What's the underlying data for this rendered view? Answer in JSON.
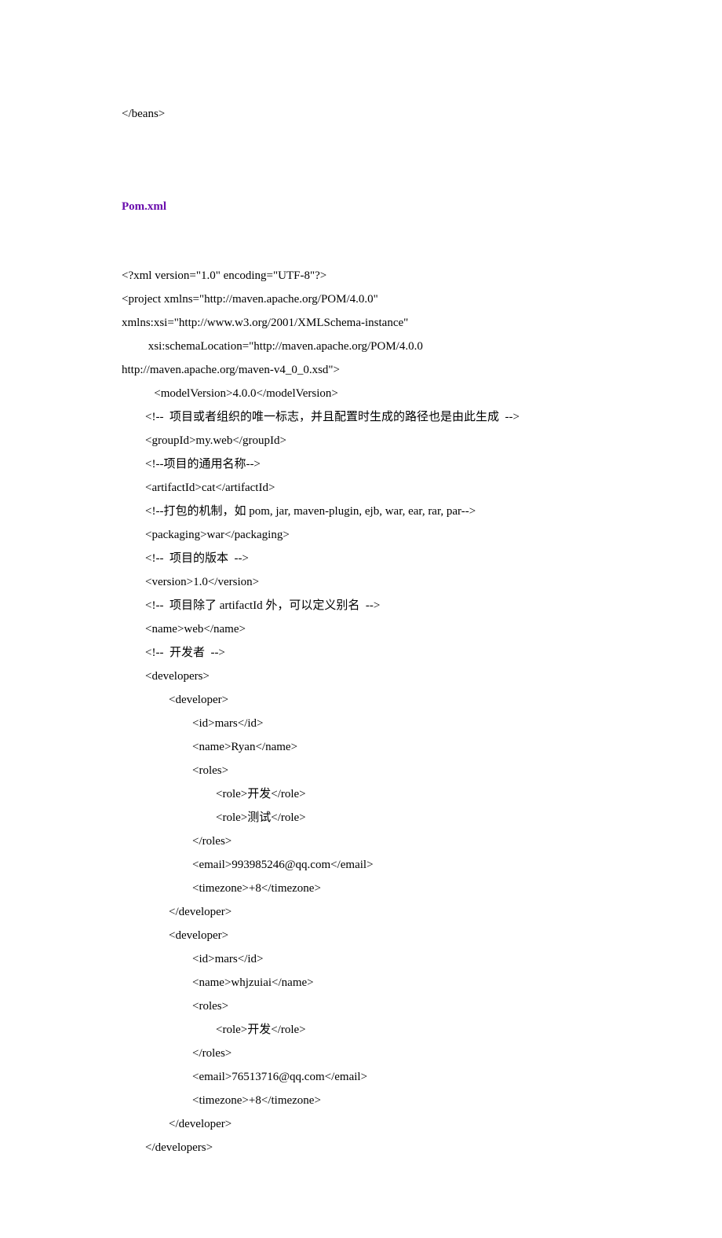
{
  "lines": [
    "</beans>",
    "",
    "",
    {
      "heading": true,
      "text": "Pom.xml"
    },
    "",
    "<?xml version=\"1.0\" encoding=\"UTF-8\"?>",
    "<project xmlns=\"http://maven.apache.org/POM/4.0.0\"",
    "xmlns:xsi=\"http://www.w3.org/2001/XMLSchema-instance\"",
    "         xsi:schemaLocation=\"http://maven.apache.org/POM/4.0.0",
    "http://maven.apache.org/maven-v4_0_0.xsd\">",
    "           <modelVersion>4.0.0</modelVersion>",
    "        <!--  项目或者组织的唯一标志，并且配置时生成的路径也是由此生成  -->",
    "        <groupId>my.web</groupId>",
    "        <!--项目的通用名称-->",
    "        <artifactId>cat</artifactId>",
    "        <!--打包的机制，如 pom, jar, maven-plugin, ejb, war, ear, rar, par-->",
    "        <packaging>war</packaging>",
    "        <!--  项目的版本  -->",
    "        <version>1.0</version>",
    "        <!--  项目除了 artifactId 外，可以定义别名  -->",
    "        <name>web</name>",
    "        <!--  开发者  -->",
    "        <developers>",
    "                <developer>",
    "                        <id>mars</id>",
    "                        <name>Ryan</name>",
    "                        <roles>",
    "                                <role>开发</role>",
    "                                <role>测试</role>",
    "                        </roles>",
    "                        <email>993985246@qq.com</email>",
    "                        <timezone>+8</timezone>",
    "                </developer>",
    "                <developer>",
    "                        <id>mars</id>",
    "                        <name>whjzuiai</name>",
    "                        <roles>",
    "                                <role>开发</role>",
    "                        </roles>",
    "                        <email>76513716@qq.com</email>",
    "                        <timezone>+8</timezone>",
    "                </developer>",
    "        </developers>"
  ]
}
